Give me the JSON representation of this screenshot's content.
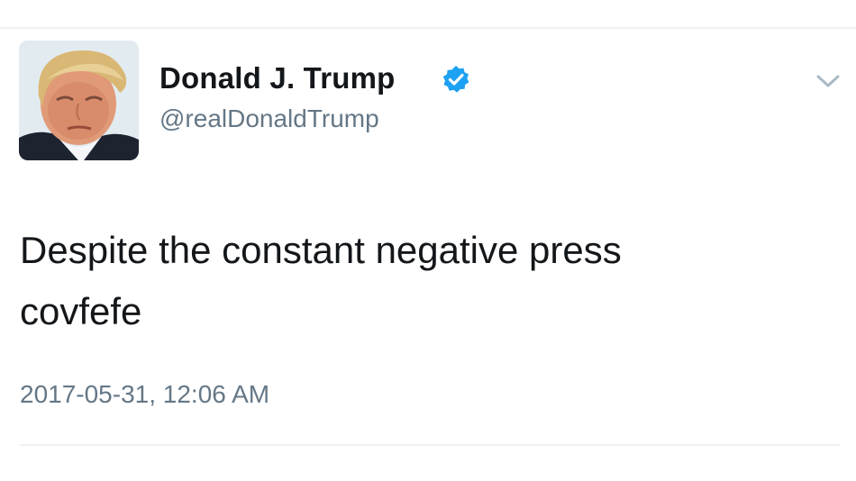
{
  "tweet": {
    "author": {
      "display_name": "Donald J. Trump",
      "handle": "@realDonaldTrump",
      "verified": true,
      "avatar_icon": "profile-photo"
    },
    "text_lines": [
      "Despite the constant negative press",
      "covfefe"
    ],
    "timestamp": "2017-05-31, 12:06 AM",
    "menu_icon": "chevron-down-icon"
  },
  "colors": {
    "text_primary": "#14171a",
    "text_secondary": "#657786",
    "verified_badge": "#1da1f2",
    "caret": "#aab8c2",
    "divider": "#eef1f3"
  }
}
